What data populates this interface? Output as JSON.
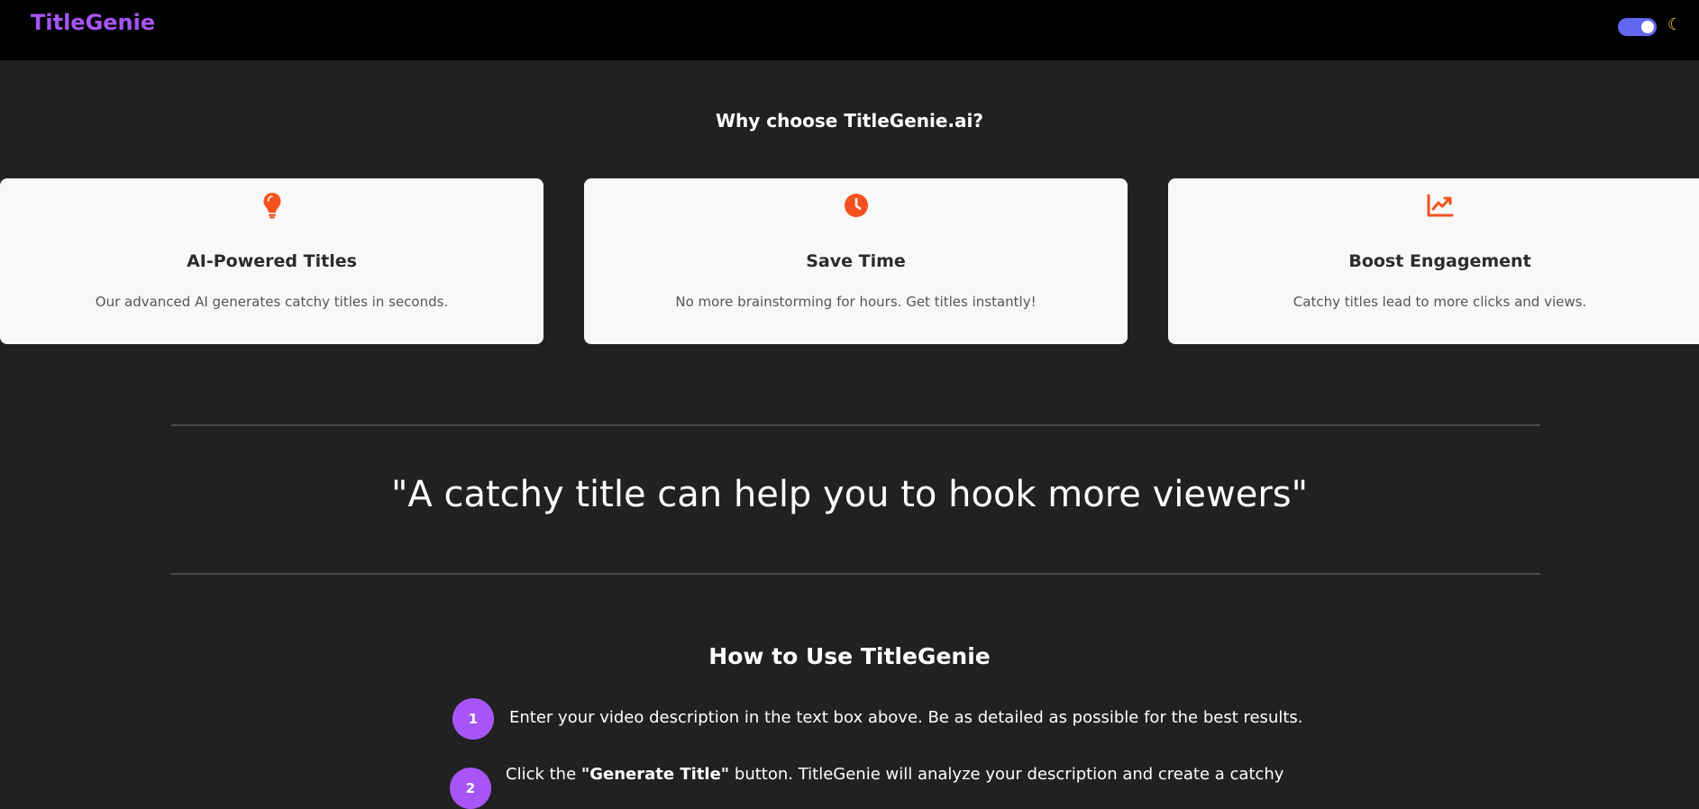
{
  "header": {
    "brand": "TitleGenie",
    "theme_toggle": "dark-mode-toggle",
    "moon_icon": "moon-icon"
  },
  "why": {
    "title": "Why choose TitleGenie.ai?",
    "cards": [
      {
        "icon": "lightbulb-icon",
        "title": "AI-Powered Titles",
        "desc": "Our advanced AI generates catchy titles in seconds."
      },
      {
        "icon": "clock-icon",
        "title": "Save Time",
        "desc": "No more brainstorming for hours. Get titles instantly!"
      },
      {
        "icon": "chart-line-icon",
        "title": "Boost Engagement",
        "desc": "Catchy titles lead to more clicks and views."
      }
    ]
  },
  "quote": "\"A catchy title can help you to hook more viewers\"",
  "howto": {
    "title": "How to Use TitleGenie",
    "steps": [
      {
        "num": "1",
        "text": "Enter your video description in the text box above. Be as detailed as possible for the best results."
      },
      {
        "num": "2",
        "before": "Click the ",
        "bold": "\"Generate Title\"",
        "after": " button. TitleGenie will analyze your description and create a catchy"
      }
    ]
  },
  "colors": {
    "accent_purple": "#a855f7",
    "icon_orange": "#f4511e",
    "toggle_indigo": "#6366f1",
    "background": "#212121",
    "navbar": "#000000",
    "card": "#f8f8f8"
  }
}
